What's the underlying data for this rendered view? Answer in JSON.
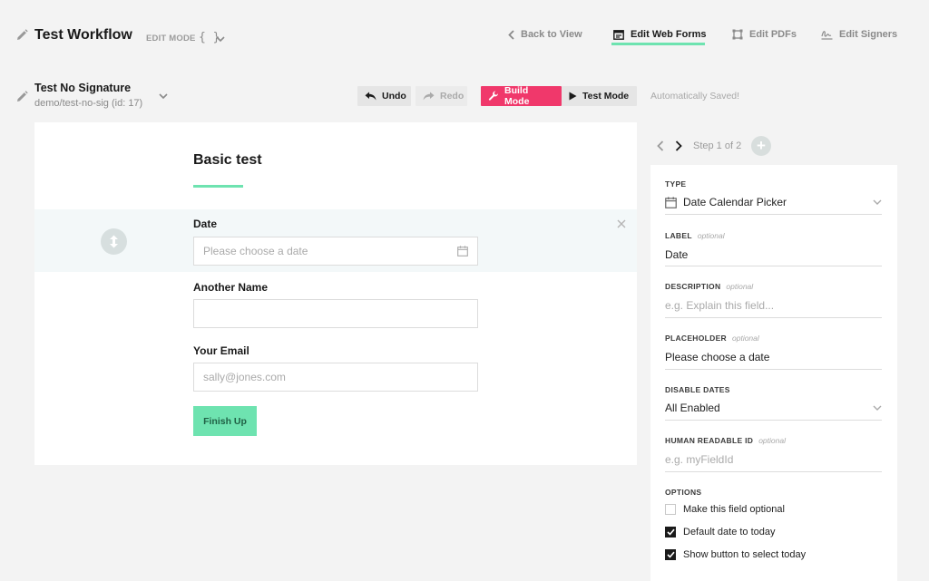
{
  "header": {
    "title": "Test Workflow",
    "mode": "EDIT MODE",
    "code_glyph": "{ }",
    "nav": [
      {
        "label": "Back to View",
        "icon": "chevron-left-icon"
      },
      {
        "label": "Edit Web Forms",
        "icon": "web-form-icon",
        "active": true
      },
      {
        "label": "Edit PDFs",
        "icon": "pdf-frame-icon"
      },
      {
        "label": "Edit Signers",
        "icon": "signature-icon"
      }
    ]
  },
  "document": {
    "title": "Test No Signature",
    "subtitle": "demo/test-no-sig (id: 17)"
  },
  "toolbar": {
    "undo": "Undo",
    "redo": "Redo",
    "build_mode": "Build Mode",
    "test_mode": "Test Mode",
    "status": "Automatically Saved!"
  },
  "form": {
    "title": "Basic test",
    "fields": [
      {
        "label": "Date",
        "placeholder": "Please choose a date",
        "selected": true
      },
      {
        "label": "Another Name",
        "placeholder": ""
      },
      {
        "label": "Your Email",
        "placeholder": "sally@jones.com"
      }
    ],
    "submit": "Finish Up"
  },
  "step_nav": {
    "label": "Step 1 of 2",
    "add": "+"
  },
  "properties": {
    "type": {
      "label": "TYPE",
      "value": "Date Calendar Picker"
    },
    "label": {
      "label": "LABEL",
      "optional": "optional",
      "value": "Date"
    },
    "description": {
      "label": "DESCRIPTION",
      "optional": "optional",
      "placeholder": "e.g. Explain this field..."
    },
    "placeholder": {
      "label": "PLACEHOLDER",
      "optional": "optional",
      "value": "Please choose a date"
    },
    "disable_dates": {
      "label": "DISABLE DATES",
      "value": "All Enabled"
    },
    "human_id": {
      "label": "HUMAN READABLE ID",
      "optional": "optional",
      "placeholder": "e.g. myFieldId"
    },
    "options_label": "OPTIONS",
    "options": [
      {
        "label": "Make this field optional",
        "checked": false
      },
      {
        "label": "Default date to today",
        "checked": true
      },
      {
        "label": "Show button to select today",
        "checked": true
      }
    ]
  },
  "colors": {
    "accent": "#6ee3b0",
    "build_mode": "#f0386b",
    "background": "#f3f3f3"
  }
}
